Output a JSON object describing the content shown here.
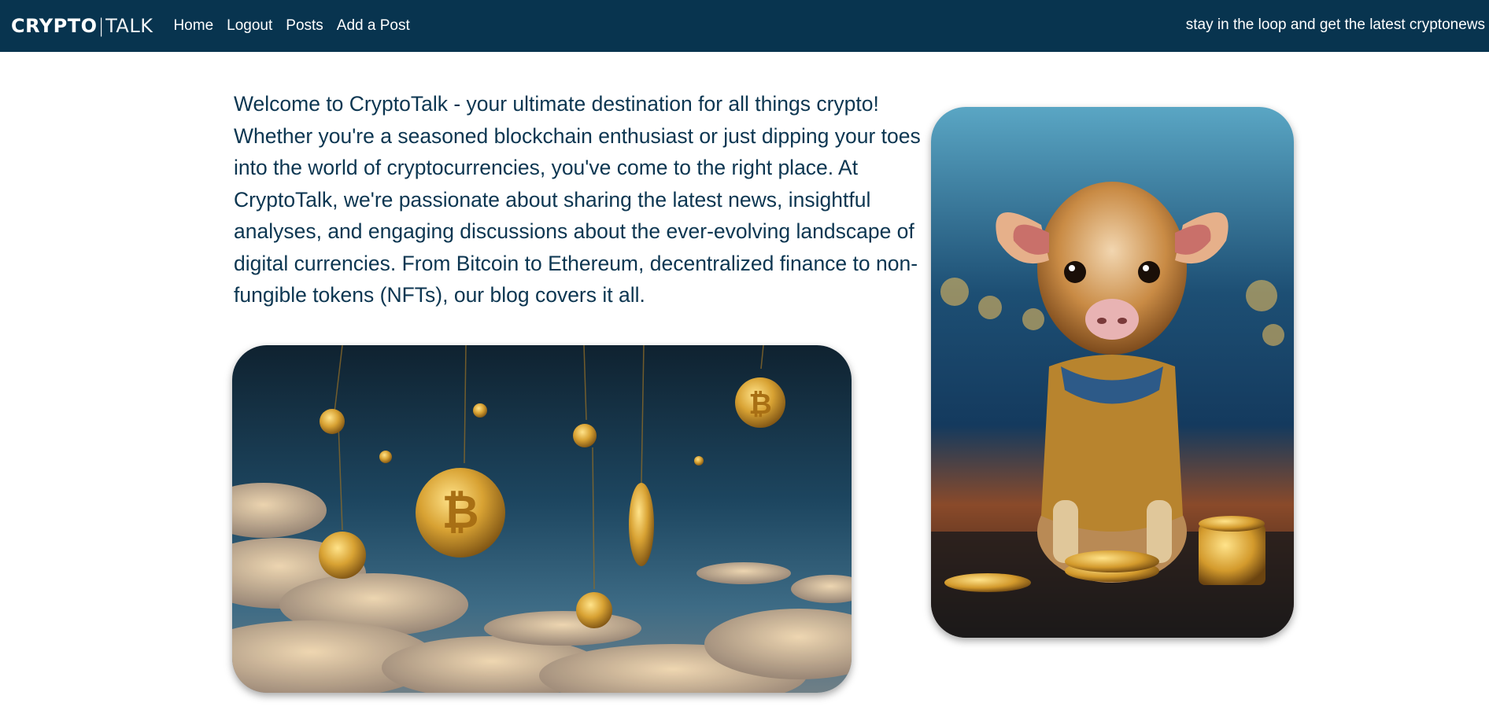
{
  "navbar": {
    "brand": {
      "bold": "CRYPTO",
      "separator": "|",
      "light": "TALK"
    },
    "links": [
      {
        "label": "Home"
      },
      {
        "label": "Logout"
      },
      {
        "label": "Posts"
      },
      {
        "label": "Add a Post"
      }
    ],
    "tagline": "stay in the loop and get the latest cryptonews"
  },
  "main": {
    "intro": "Welcome to CryptoTalk - your ultimate destination for all things crypto! Whether you're a seasoned blockchain enthusiast or just dipping your toes into the world of cryptocurrencies, you've come to the right place. At CryptoTalk, we're passionate about sharing the latest news, insightful analyses, and engaging discussions about the ever-evolving landscape of digital currencies. From Bitcoin to Ethereum, decentralized finance to non-fungible tokens (NFTs), our blog covers it all."
  },
  "colors": {
    "navbar_bg": "#08344f",
    "text": "#0c3651"
  },
  "icons": {
    "coins_image": "hanging-bitcoin-coins-illustration",
    "calf_image": "calf-with-coins-illustration"
  }
}
